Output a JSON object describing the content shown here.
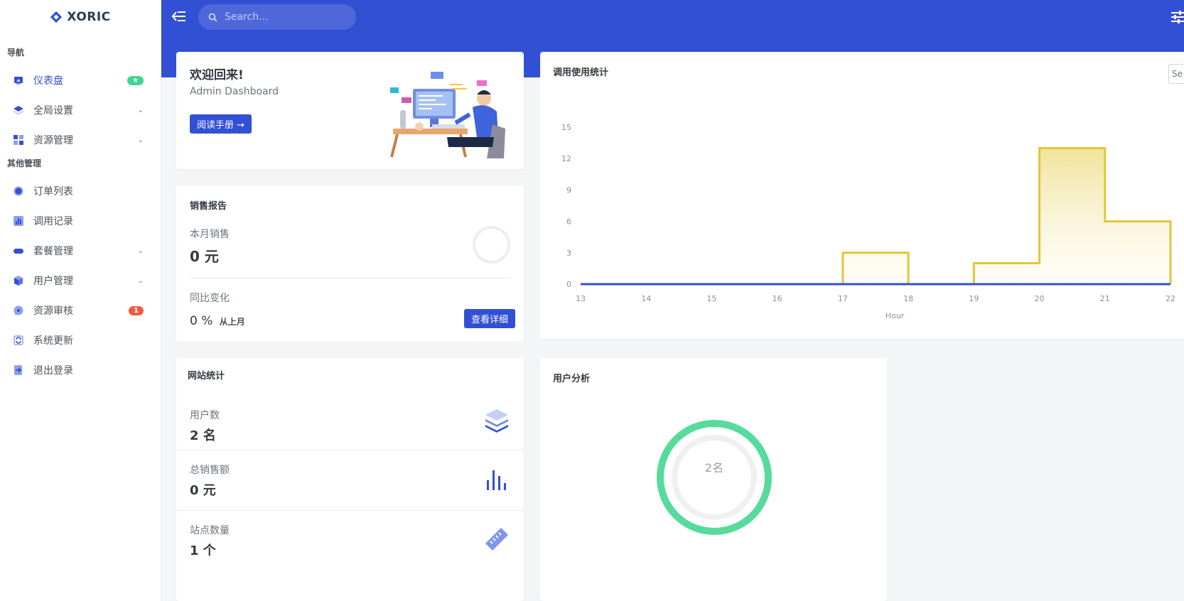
{
  "brand": {
    "name": "XORIC"
  },
  "sidebar": {
    "sections": [
      {
        "heading": "导航"
      },
      {
        "heading": "其他管理"
      }
    ],
    "items": [
      {
        "label": "仪表盘",
        "icon": "dashboard-icon",
        "badge": "★",
        "active": true
      },
      {
        "label": "全局设置",
        "icon": "layers-icon",
        "has_submenu": true
      },
      {
        "label": "资源管理",
        "icon": "grid-icon",
        "has_submenu": true
      },
      {
        "label": "订单列表",
        "icon": "circle-icon"
      },
      {
        "label": "调用记录",
        "icon": "bar-chart-icon"
      },
      {
        "label": "套餐管理",
        "icon": "pill-icon",
        "has_submenu": true
      },
      {
        "label": "用户管理",
        "icon": "box-icon",
        "has_submenu": true
      },
      {
        "label": "资源审核",
        "icon": "chat-icon",
        "badge": "1"
      },
      {
        "label": "系统更新",
        "icon": "refresh-icon"
      },
      {
        "label": "退出登录",
        "icon": "logout-icon"
      }
    ]
  },
  "topbar": {
    "search_placeholder": "Search..."
  },
  "welcome": {
    "title": "欢迎回来!",
    "subtitle": "Admin Dashboard",
    "button_label": "阅读手册 →"
  },
  "sales": {
    "title": "销售报告",
    "month_label": "本月销售",
    "month_value": "0 元",
    "change_label": "同比变化",
    "change_value": "0 %",
    "change_suffix": "从上月",
    "detail_button": "查看详细"
  },
  "site_stats": {
    "title": "网站统计",
    "rows": [
      {
        "label": "用户数",
        "value": "2 名",
        "icon": "layers-stack-icon"
      },
      {
        "label": "总销售额",
        "value": "0 元",
        "icon": "bar-chart-icon"
      },
      {
        "label": "站点数量",
        "value": "1 个",
        "icon": "ruler-icon"
      }
    ]
  },
  "usage": {
    "title": "调用使用统计",
    "select_text": "Se"
  },
  "analysis": {
    "title": "用户分析",
    "donut_label": "2名"
  },
  "colors": {
    "primary": "#3250d4",
    "accent_green": "#3ed694",
    "accent_red": "#f25b3a",
    "chart_yellow": "#e2c53a",
    "donut_green": "#56db9c"
  },
  "chart_data": {
    "type": "area",
    "title": "",
    "xlabel": "Hour",
    "ylabel": "",
    "x": [
      13,
      14,
      15,
      16,
      17,
      18,
      19,
      20,
      21,
      22
    ],
    "x_tick_labels": [
      "13",
      "14",
      "15",
      "16",
      "17",
      "18",
      "19",
      "20",
      "21",
      "22"
    ],
    "y_ticks": [
      0,
      3,
      6,
      9,
      12,
      15
    ],
    "ylim": [
      0,
      15
    ],
    "step": true,
    "series": [
      {
        "name": "",
        "color": "#e2c53a",
        "values": [
          0,
          0,
          0,
          0,
          3,
          0,
          2,
          13,
          6,
          0
        ]
      },
      {
        "name": "",
        "color": "#3250d4",
        "values": [
          0,
          0,
          0,
          0,
          0,
          0,
          0,
          0,
          0,
          0
        ]
      }
    ]
  }
}
